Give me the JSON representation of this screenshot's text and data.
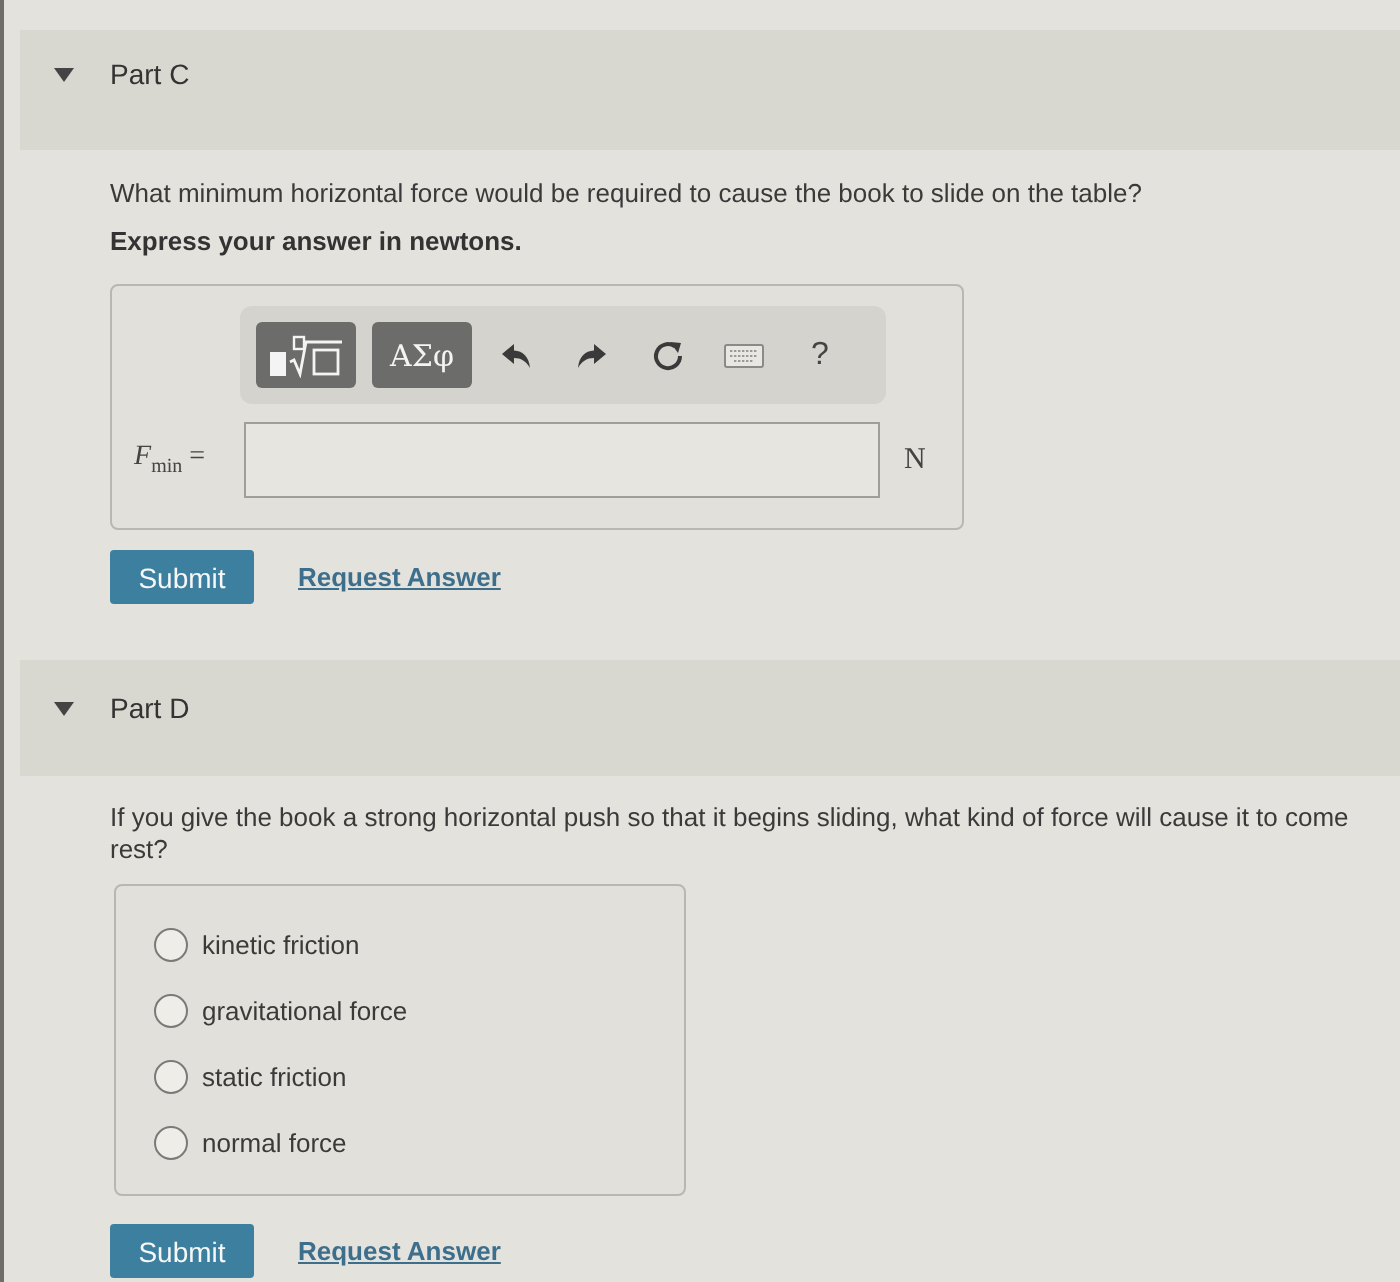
{
  "parts": [
    {
      "kind": "numeric",
      "title": "Part C",
      "expanded": true,
      "question": "What minimum horizontal force would be required to cause the book to slide on the table?",
      "instruction": "Express your answer in newtons.",
      "toolbar": {
        "symbols_label": "ΑΣφ",
        "help_label": "?"
      },
      "answer": {
        "label": "*F*$_{min}$ =",
        "unit": "N"
      },
      "submit": "Submit",
      "request_answer": "Request Answer"
    },
    {
      "kind": "multiple_choice",
      "title": "Part D",
      "expanded": true,
      "question": "If you give the book a strong horizontal push so that it begins sliding, what kind of force will cause it to come rest?",
      "options": [
        {
          "label": "kinetic friction",
          "selected": false
        },
        {
          "label": "gravitational force",
          "selected": false
        },
        {
          "label": "static friction",
          "selected": false
        },
        {
          "label": "normal force",
          "selected": false
        }
      ],
      "submit": "Submit",
      "request_answer": "Request Answer"
    }
  ]
}
